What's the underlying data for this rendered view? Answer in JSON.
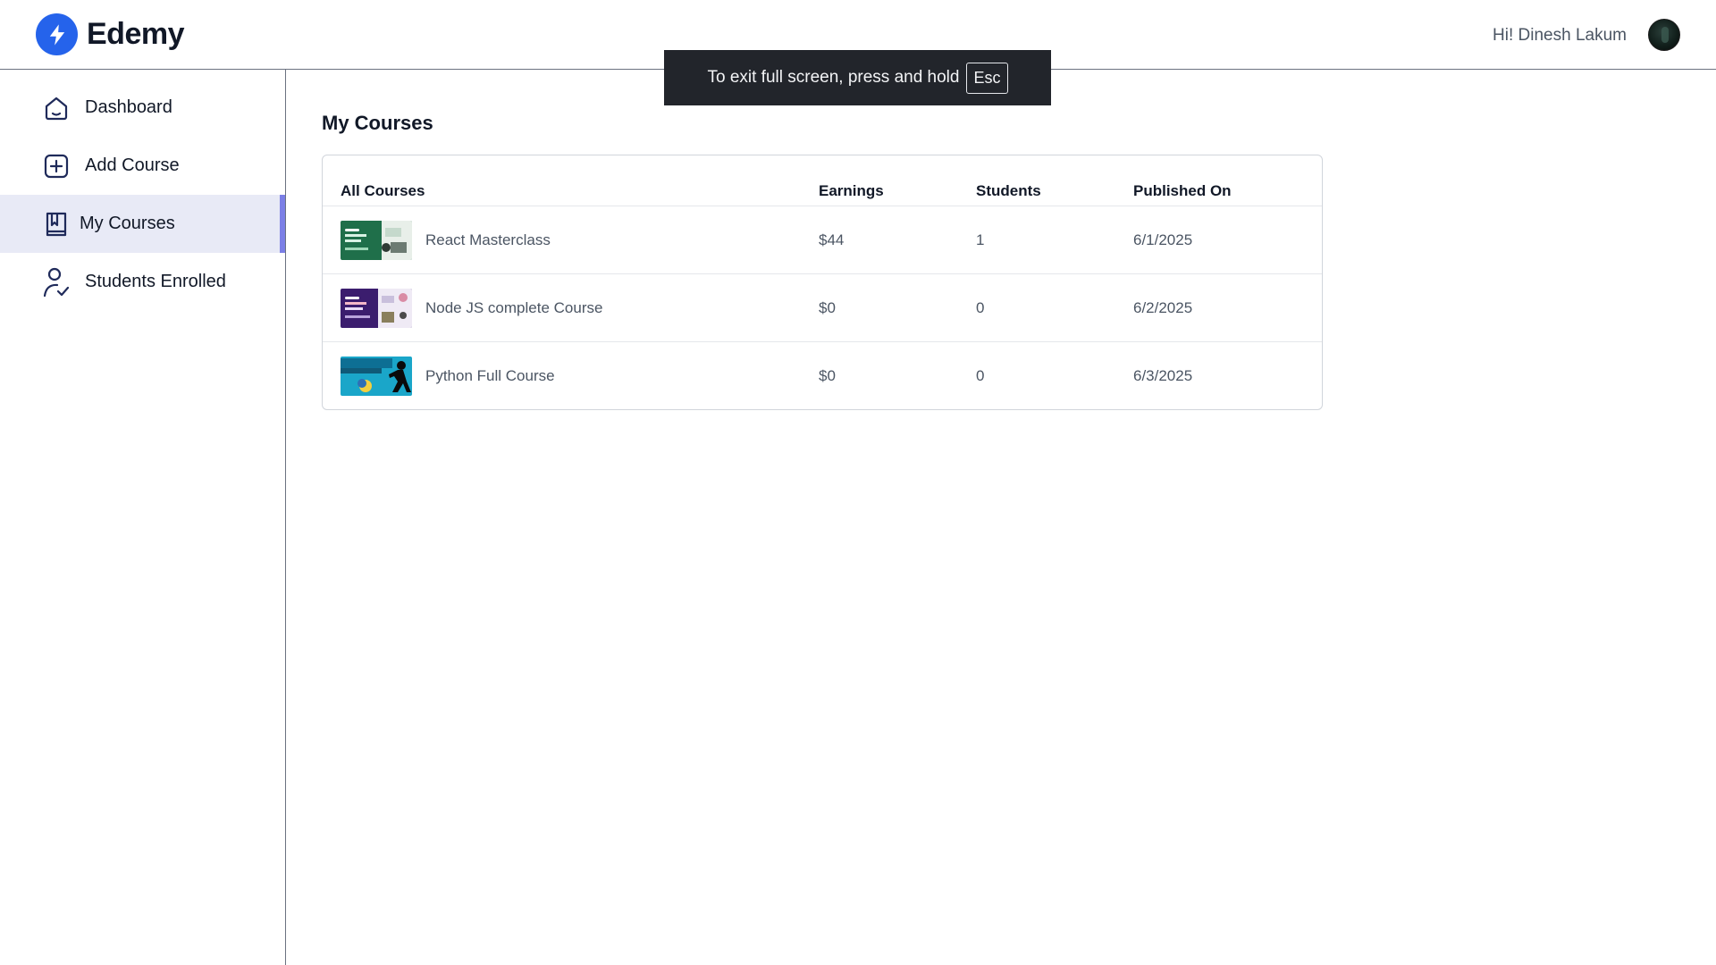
{
  "brand": {
    "name": "Edemy",
    "accent": "#2563eb",
    "logo_icon": "lightning-icon"
  },
  "header": {
    "greeting": "Hi! Dinesh Lakum",
    "avatar_icon": "user-avatar"
  },
  "sidebar": {
    "active_color": "#7b7fe6",
    "items": [
      {
        "label": "Dashboard",
        "icon": "home-icon"
      },
      {
        "label": "Add Course",
        "icon": "add-square-icon"
      },
      {
        "label": "My Courses",
        "icon": "bookmark-book-icon",
        "active": true
      },
      {
        "label": "Students Enrolled",
        "icon": "user-check-icon"
      }
    ]
  },
  "main": {
    "title": "My Courses",
    "columns": [
      "All Courses",
      "Earnings",
      "Students",
      "Published On"
    ],
    "rows": [
      {
        "course": "React Masterclass",
        "earnings": "$44",
        "students": "1",
        "published": "6/1/2025",
        "thumb": "green-thumbnail"
      },
      {
        "course": "Node JS complete Course",
        "earnings": "$0",
        "students": "0",
        "published": "6/2/2025",
        "thumb": "purple-thumbnail"
      },
      {
        "course": "Python Full Course",
        "earnings": "$0",
        "students": "0",
        "published": "6/3/2025",
        "thumb": "python-thumbnail"
      }
    ]
  },
  "toast": {
    "text": "To exit full screen, press and hold",
    "key": "Esc"
  }
}
